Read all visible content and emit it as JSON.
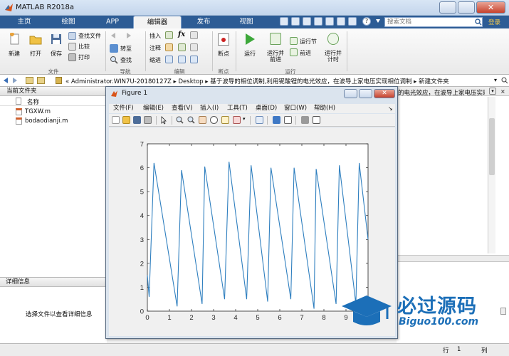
{
  "window": {
    "title": "MATLAB R2018a"
  },
  "tabs": [
    "主页",
    "绘图",
    "APP",
    "编辑器",
    "发布",
    "视图"
  ],
  "active_tab": "编辑器",
  "search": {
    "placeholder": "搜索文档"
  },
  "login_label": "登录",
  "ribbon": {
    "file_group": {
      "label": "文件",
      "new": "新建",
      "open": "打开",
      "save": "保存",
      "find_files": "查找文件",
      "compare": "比较",
      "print": "打印"
    },
    "nav_group": {
      "label": "导航",
      "goto": "转至",
      "find": "查找"
    },
    "edit_group": {
      "label": "编辑",
      "insert": "插入",
      "comment": "注释",
      "indent": "缩进",
      "fx": "fx"
    },
    "breakpoint_group": {
      "label": "断点",
      "breakpoint": "断点"
    },
    "run_group": {
      "label": "运行",
      "run": "运行",
      "run_advance": "运行并\n前进",
      "run_section": "运行节",
      "advance": "前进",
      "run_time": "运行并\n计时"
    }
  },
  "address": {
    "segments": [
      "Administrator.WIN7U-20180127Z",
      "Desktop",
      "基于波导的相位调制,利用铌酸锂的电光效应，在波导上家电压实现相位调制",
      "新建文件夹"
    ],
    "prefix": "«"
  },
  "current_folder": {
    "header": "当前文件夹",
    "column_name": "名称",
    "files": [
      {
        "name": "TGXW.m"
      },
      {
        "name": "bodaodianji.m"
      }
    ]
  },
  "details": {
    "header": "详细信息",
    "hint": "选择文件以查看详细信息"
  },
  "background_fragment": "的电光效应，在波导上家电压实现相位",
  "status": {
    "line_label": "行",
    "line_value": "1",
    "col_label": "列"
  },
  "figure": {
    "title": "Figure 1",
    "menu": [
      "文件(F)",
      "编辑(E)",
      "查看(V)",
      "插入(I)",
      "工具(T)",
      "桌面(D)",
      "窗口(W)",
      "帮助(H)"
    ]
  },
  "watermark": {
    "brand": "必过源码",
    "url": "Biguo100.com"
  },
  "colors": {
    "line": "#2f7fbf",
    "tabbar": "#2d5c95"
  },
  "chart_data": {
    "type": "line",
    "title": "",
    "xlabel": "",
    "ylabel": "",
    "xlim": [
      0,
      10
    ],
    "ylim": [
      0,
      7
    ],
    "xticks": [
      0,
      1,
      2,
      3,
      4,
      5,
      6,
      7,
      8,
      9
    ],
    "yticks": [
      0,
      1,
      2,
      3,
      4,
      5,
      6,
      7
    ],
    "grid": false,
    "series": [
      {
        "x": [
          0,
          0.08,
          0.3,
          1.35,
          1.55,
          2.48,
          2.6,
          3.5,
          3.7,
          4.5,
          4.7,
          5.45,
          5.6,
          6.5,
          6.65,
          7.55,
          7.65,
          8.55,
          8.7,
          9.45,
          9.6,
          10
        ],
        "y": [
          1.5,
          0.6,
          6.2,
          0.2,
          5.9,
          0.3,
          6.05,
          0.5,
          6.25,
          0.5,
          6.1,
          0.4,
          6.0,
          0.5,
          6.0,
          0.1,
          5.95,
          0.3,
          6.1,
          0.3,
          6.2,
          3.0
        ]
      }
    ]
  }
}
